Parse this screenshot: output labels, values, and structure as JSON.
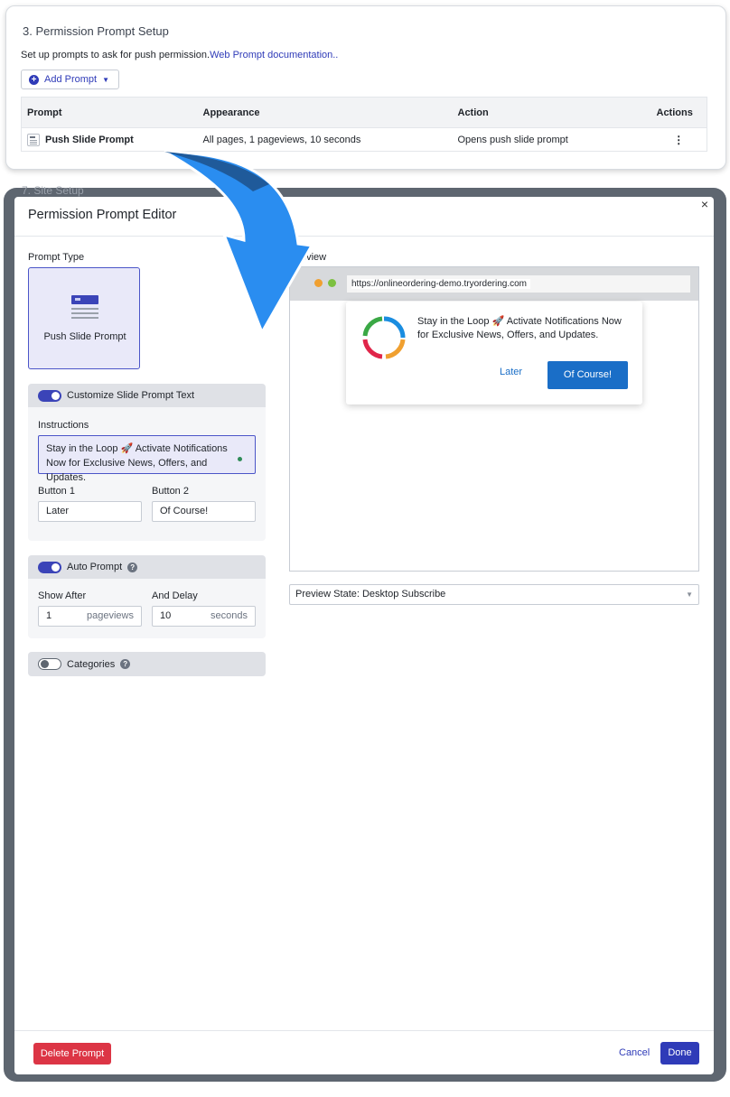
{
  "setup": {
    "section_title": "3.  Permission Prompt Setup",
    "description": "Set up prompts to ask for push permission.",
    "doc_link": "Web Prompt documentation..",
    "add_prompt_label": "Add Prompt",
    "table": {
      "headers": [
        "Prompt",
        "Appearance",
        "Action",
        "Actions"
      ],
      "rows": [
        {
          "prompt": "Push Slide Prompt",
          "appearance": "All pages, 1 pageviews, 10 seconds",
          "action": "Opens push slide prompt",
          "actions": "⋮"
        }
      ]
    }
  },
  "peek_text": "7.  Site Setup",
  "modal": {
    "title": "Permission Prompt Editor",
    "close": "×",
    "prompt_type_label": "Prompt Type",
    "prompt_type_tile": "Push Slide Prompt",
    "customize": {
      "label": "Customize Slide Prompt Text",
      "enabled": true,
      "instructions_label": "Instructions",
      "instructions_value": "Stay in the Loop 🚀 Activate Notifications Now for Exclusive News, Offers, and Updates.",
      "button1_label": "Button 1",
      "button1_value": "Later",
      "button2_label": "Button 2",
      "button2_value": "Of Course!"
    },
    "auto_prompt": {
      "label": "Auto Prompt",
      "enabled": true,
      "show_after_label": "Show After",
      "show_after_value": "1",
      "show_after_unit": "pageviews",
      "delay_label": "And Delay",
      "delay_value": "10",
      "delay_unit": "seconds"
    },
    "categories": {
      "label": "Categories",
      "enabled": false
    },
    "preview": {
      "label": "Preview",
      "url": "https://onlineordering-demo.tryordering.com",
      "message": "Stay in the Loop 🚀 Activate Notifications Now for Exclusive News, Offers, and Updates.",
      "later": "Later",
      "accept": "Of Course!"
    },
    "preview_state": "Preview State: Desktop Subscribe",
    "footer": {
      "delete": "Delete Prompt",
      "cancel": "Cancel",
      "done": "Done"
    }
  },
  "colors": {
    "accent": "#2f3bb8",
    "danger": "#dc3545",
    "preview_button": "#1a6ec7",
    "arrow": "#2a8df0"
  }
}
